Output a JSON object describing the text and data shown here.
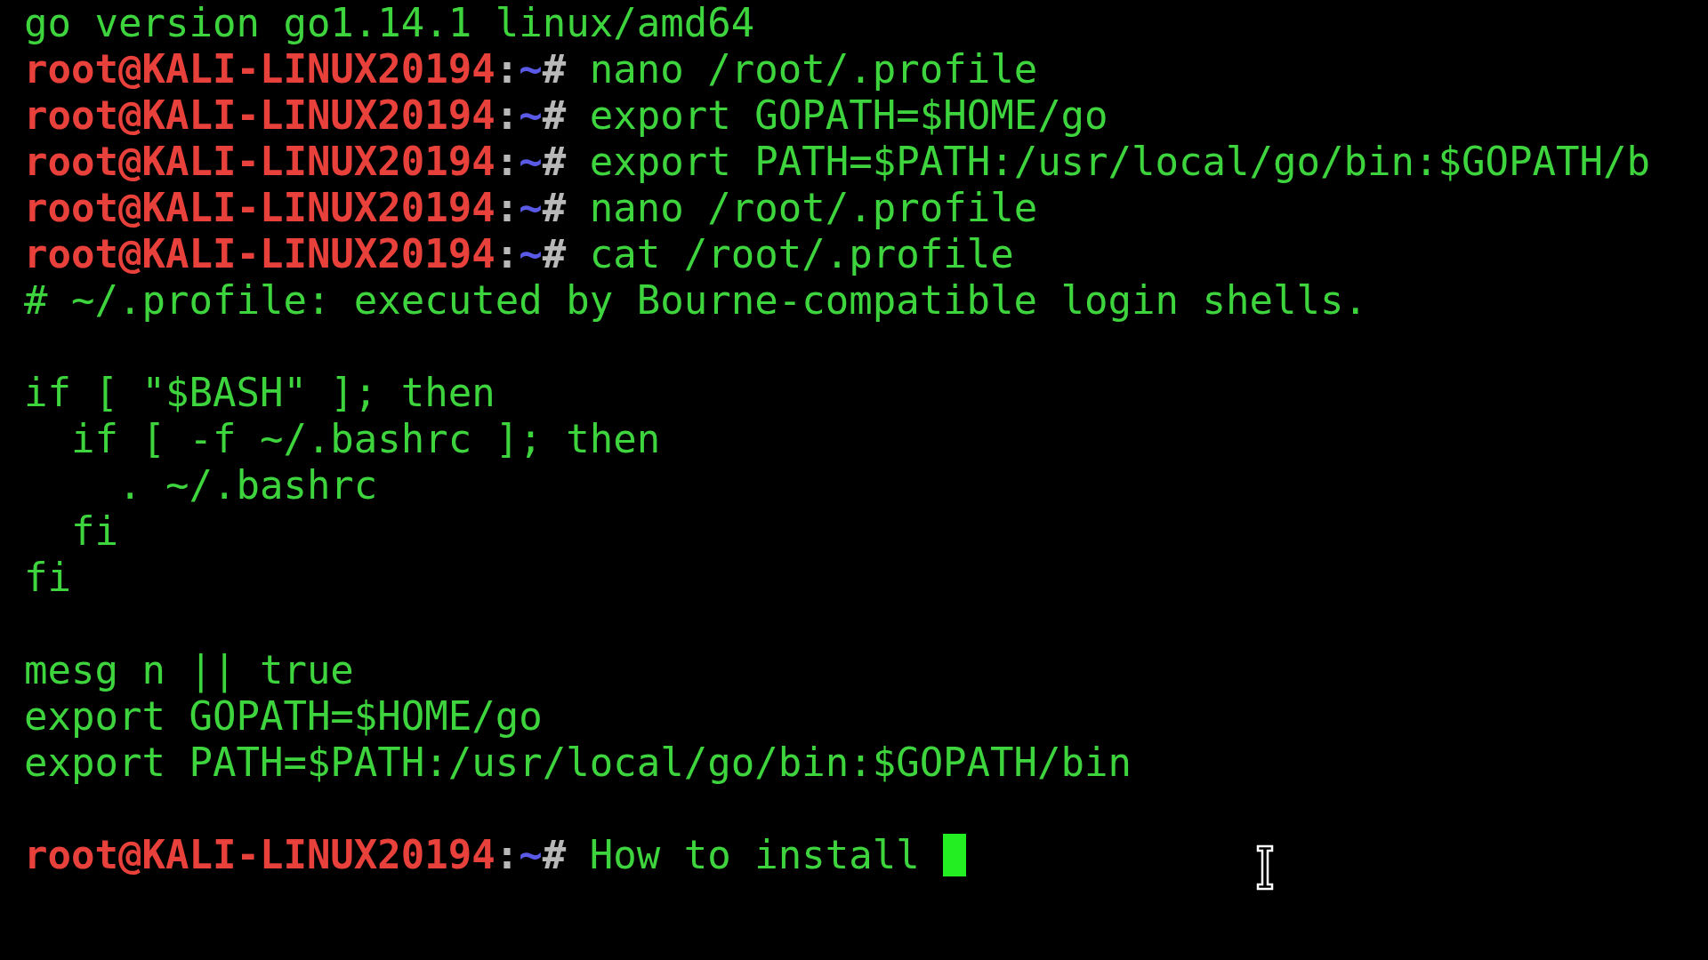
{
  "terminal": {
    "lines": [
      {
        "kind": "output",
        "text": "go version go1.14.1 linux/amd64"
      },
      {
        "kind": "prompt",
        "user_host": "root@KALI-LINUX20194",
        "separator": ":",
        "path": "~",
        "symbol": "#",
        "command": "nano /root/.profile",
        "cursor": false
      },
      {
        "kind": "prompt",
        "user_host": "root@KALI-LINUX20194",
        "separator": ":",
        "path": "~",
        "symbol": "#",
        "command": "export GOPATH=$HOME/go",
        "cursor": false
      },
      {
        "kind": "prompt",
        "user_host": "root@KALI-LINUX20194",
        "separator": ":",
        "path": "~",
        "symbol": "#",
        "command": "export PATH=$PATH:/usr/local/go/bin:$GOPATH/b",
        "cursor": false
      },
      {
        "kind": "prompt",
        "user_host": "root@KALI-LINUX20194",
        "separator": ":",
        "path": "~",
        "symbol": "#",
        "command": "nano /root/.profile",
        "cursor": false
      },
      {
        "kind": "prompt",
        "user_host": "root@KALI-LINUX20194",
        "separator": ":",
        "path": "~",
        "symbol": "#",
        "command": "cat /root/.profile",
        "cursor": false
      },
      {
        "kind": "output",
        "text": "# ~/.profile: executed by Bourne-compatible login shells."
      },
      {
        "kind": "blank"
      },
      {
        "kind": "output",
        "text": "if [ \"$BASH\" ]; then"
      },
      {
        "kind": "output",
        "text": "  if [ -f ~/.bashrc ]; then"
      },
      {
        "kind": "output",
        "text": "    . ~/.bashrc"
      },
      {
        "kind": "output",
        "text": "  fi"
      },
      {
        "kind": "output",
        "text": "fi"
      },
      {
        "kind": "blank"
      },
      {
        "kind": "output",
        "text": "mesg n || true"
      },
      {
        "kind": "output",
        "text": "export GOPATH=$HOME/go"
      },
      {
        "kind": "output",
        "text": "export PATH=$PATH:/usr/local/go/bin:$GOPATH/bin"
      },
      {
        "kind": "blank"
      },
      {
        "kind": "prompt",
        "user_host": "root@KALI-LINUX20194",
        "separator": ":",
        "path": "~",
        "symbol": "#",
        "command": "How to install ",
        "cursor": true
      }
    ]
  }
}
